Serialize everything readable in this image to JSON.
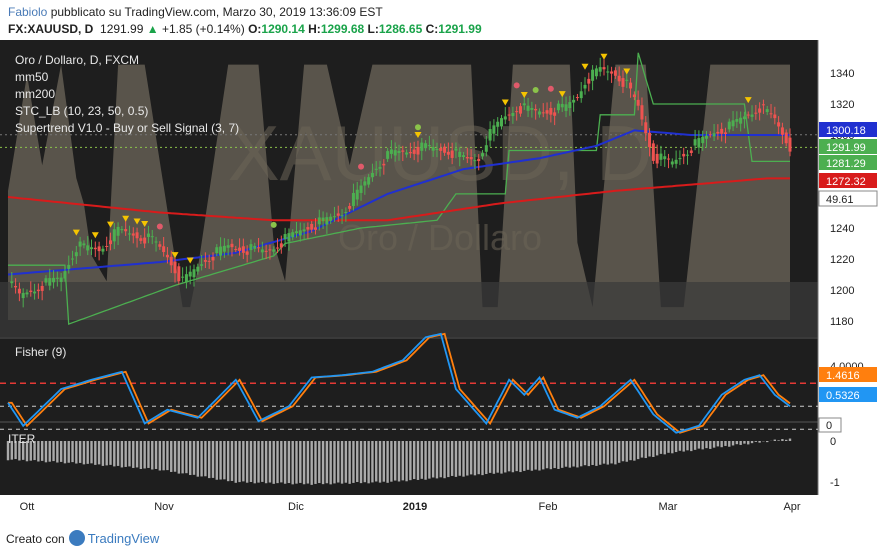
{
  "header": {
    "user": "Fabiolo",
    "published": " pubblicato su TradingView.com, Marzo 30, 2019 13:36:09 EST",
    "symbol": "FX:XAUUSD, D",
    "last": "1291.99",
    "arrow": "▲",
    "change": "+1.85 (+0.14%)",
    "o_label": "O:",
    "o_value": "1290.14",
    "h_label": "H:",
    "h_value": "1299.68",
    "l_label": "L:",
    "l_value": "1286.65",
    "c_label": "C:",
    "c_value": "1291.99"
  },
  "legend": {
    "title": "Oro / Dollaro, D, FXCM",
    "line2": "mm50",
    "line3": "mm200",
    "line4": "STC_LB (10, 23, 50, 0.5)",
    "line5": "Supertrend V1.0 - Buy or Sell Signal (3, 7)"
  },
  "watermark": {
    "symbol": "XAUUSD, D",
    "name": "Oro / Dollaro"
  },
  "footer": {
    "created": "Creato con",
    "brand": "TradingView"
  },
  "colors": {
    "up": "#26a69a",
    "down": "#ef5350",
    "bull_candle": "#4caf50",
    "mm50": "#2030d0",
    "mm200": "#d81b1b",
    "supertrend": "#4caf50",
    "stc_fill": "#8b8271",
    "fisher": "#2196f3",
    "trigger": "#ff7f0e",
    "iter": "#aaaaaa"
  },
  "chart_data": [
    {
      "type": "candlestick",
      "title": "Oro / Dollaro, D, FXCM",
      "ylim": [
        1175,
        1355
      ],
      "y_ticks": [
        1180,
        1200,
        1220,
        1240,
        1260,
        1280,
        1300,
        1320,
        1340
      ],
      "x_ticks": [
        "Ott",
        "Nov",
        "Dic",
        "2019",
        "Feb",
        "Mar",
        "Apr"
      ],
      "price_labels": [
        {
          "value": "1300.18",
          "color": "#2030d0"
        },
        {
          "value": "1291.99",
          "color": "#4caf50"
        },
        {
          "value": "1281.29",
          "color": "#4caf50"
        },
        {
          "value": "1272.32",
          "color": "#d81b1b"
        },
        {
          "value": "49.61",
          "color": "#ffffff"
        }
      ],
      "close_anchors": [
        [
          0,
          1205
        ],
        [
          3,
          1196
        ],
        [
          8,
          1202
        ],
        [
          14,
          1208
        ],
        [
          18,
          1228
        ],
        [
          24,
          1226
        ],
        [
          29,
          1238
        ],
        [
          33,
          1236
        ],
        [
          38,
          1232
        ],
        [
          42,
          1222
        ],
        [
          46,
          1205
        ],
        [
          52,
          1220
        ],
        [
          58,
          1228
        ],
        [
          64,
          1226
        ],
        [
          68,
          1225
        ],
        [
          70,
          1228
        ],
        [
          74,
          1234
        ],
        [
          78,
          1240
        ],
        [
          83,
          1244
        ],
        [
          88,
          1250
        ],
        [
          92,
          1262
        ],
        [
          97,
          1280
        ],
        [
          101,
          1288
        ],
        [
          106,
          1290
        ],
        [
          110,
          1292
        ],
        [
          116,
          1290
        ],
        [
          121,
          1284
        ],
        [
          124,
          1285
        ],
        [
          126,
          1297
        ],
        [
          130,
          1310
        ],
        [
          134,
          1318
        ],
        [
          139,
          1315
        ],
        [
          144,
          1316
        ],
        [
          147,
          1318
        ],
        [
          150,
          1325
        ],
        [
          152,
          1335
        ],
        [
          156,
          1342
        ],
        [
          160,
          1340
        ],
        [
          163,
          1332
        ],
        [
          166,
          1318
        ],
        [
          170,
          1286
        ],
        [
          175,
          1282
        ],
        [
          180,
          1292
        ],
        [
          186,
          1302
        ],
        [
          190,
          1305
        ],
        [
          194,
          1312
        ],
        [
          198,
          1318
        ],
        [
          202,
          1310
        ],
        [
          206,
          1292
        ]
      ],
      "mm50_anchors": [
        [
          0,
          1210
        ],
        [
          20,
          1214
        ],
        [
          40,
          1218
        ],
        [
          60,
          1224
        ],
        [
          80,
          1238
        ],
        [
          100,
          1262
        ],
        [
          120,
          1278
        ],
        [
          140,
          1285
        ],
        [
          155,
          1293
        ],
        [
          165,
          1303
        ],
        [
          180,
          1300
        ],
        [
          200,
          1300
        ],
        [
          206,
          1300
        ]
      ],
      "mm200_anchors": [
        [
          0,
          1260
        ],
        [
          40,
          1250
        ],
        [
          70,
          1245
        ],
        [
          100,
          1245
        ],
        [
          130,
          1256
        ],
        [
          160,
          1264
        ],
        [
          180,
          1268
        ],
        [
          200,
          1272
        ],
        [
          206,
          1272
        ]
      ],
      "supertrend_anchors": [
        [
          0,
          1216
        ],
        [
          15,
          1216
        ],
        [
          16,
          1178
        ],
        [
          44,
          1203
        ],
        [
          70,
          1222
        ],
        [
          73,
          1230
        ],
        [
          93,
          1240
        ],
        [
          113,
          1245
        ],
        [
          118,
          1262
        ],
        [
          131,
          1262
        ],
        [
          132,
          1290
        ],
        [
          155,
          1290
        ],
        [
          156,
          1313
        ],
        [
          165,
          1313
        ],
        [
          166,
          1353
        ],
        [
          170,
          1320
        ],
        [
          192,
          1320
        ],
        [
          194,
          1320
        ],
        [
          196,
          1283
        ],
        [
          206,
          1283
        ]
      ],
      "sell_markers": [
        18,
        23,
        27,
        31,
        34,
        36,
        44,
        48,
        108,
        131,
        136,
        146,
        152,
        157,
        163,
        195
      ],
      "buy_markers": [
        40,
        70,
        93,
        108,
        134,
        139,
        143
      ]
    },
    {
      "type": "area",
      "title": "STC_LB (10, 23, 50, 0.5)",
      "ylim": [
        0,
        100
      ],
      "anchors": [
        [
          0,
          50
        ],
        [
          5,
          95
        ],
        [
          9,
          60
        ],
        [
          14,
          99
        ],
        [
          18,
          55
        ],
        [
          20,
          45
        ],
        [
          22,
          25
        ],
        [
          26,
          15
        ],
        [
          29,
          99
        ],
        [
          36,
          99
        ],
        [
          46,
          5
        ],
        [
          48,
          5
        ],
        [
          50,
          20
        ],
        [
          58,
          99
        ],
        [
          66,
          99
        ],
        [
          70,
          30
        ],
        [
          73,
          15
        ],
        [
          78,
          99
        ],
        [
          84,
          99
        ],
        [
          90,
          60
        ],
        [
          96,
          99
        ],
        [
          104,
          99
        ],
        [
          114,
          99
        ],
        [
          122,
          99
        ],
        [
          125,
          5
        ],
        [
          129,
          5
        ],
        [
          133,
          99
        ],
        [
          142,
          99
        ],
        [
          148,
          99
        ],
        [
          150,
          30
        ],
        [
          154,
          5
        ],
        [
          160,
          99
        ],
        [
          168,
          99
        ],
        [
          172,
          5
        ],
        [
          178,
          5
        ],
        [
          185,
          99
        ],
        [
          198,
          99
        ],
        [
          203,
          99
        ],
        [
          206,
          99
        ]
      ]
    },
    {
      "type": "line",
      "title": "Fisher (9)",
      "ylim": [
        -3,
        5
      ],
      "y_ticks": [
        4.0
      ],
      "level_lines": [
        2.5,
        0.5,
        -1.5
      ],
      "last_values": {
        "fisher": "0.5326",
        "trigger": "1.4616"
      },
      "tick_label": "4.0000",
      "anchors": [
        [
          0,
          0.8
        ],
        [
          4,
          -1.2
        ],
        [
          14,
          2.0
        ],
        [
          22,
          2.8
        ],
        [
          30,
          3.5
        ],
        [
          36,
          -1.0
        ],
        [
          42,
          0.2
        ],
        [
          50,
          -0.5
        ],
        [
          54,
          0.8
        ],
        [
          60,
          2.8
        ],
        [
          66,
          -0.8
        ],
        [
          74,
          0.5
        ],
        [
          80,
          3.0
        ],
        [
          88,
          3.2
        ],
        [
          96,
          3.5
        ],
        [
          104,
          4.5
        ],
        [
          110,
          6.5
        ],
        [
          114,
          6.8
        ],
        [
          118,
          2.0
        ],
        [
          126,
          -1.0
        ],
        [
          132,
          2.8
        ],
        [
          136,
          1.5
        ],
        [
          140,
          3.0
        ],
        [
          144,
          0.2
        ],
        [
          150,
          -0.5
        ],
        [
          156,
          0.5
        ],
        [
          164,
          2.8
        ],
        [
          170,
          -0.2
        ],
        [
          176,
          -1.8
        ],
        [
          182,
          -1.2
        ],
        [
          188,
          1.5
        ],
        [
          194,
          2.8
        ],
        [
          198,
          3.2
        ],
        [
          202,
          1.5
        ],
        [
          206,
          0.5
        ]
      ]
    },
    {
      "type": "bar",
      "title": "ITER",
      "ylim": [
        -1.1,
        0.1
      ],
      "y_ticks": [
        0,
        -1
      ],
      "last_value": "0",
      "anchors": [
        [
          0,
          -0.45
        ],
        [
          20,
          -0.55
        ],
        [
          40,
          -0.7
        ],
        [
          60,
          -1.0
        ],
        [
          80,
          -1.05
        ],
        [
          100,
          -1.0
        ],
        [
          120,
          -0.85
        ],
        [
          140,
          -0.7
        ],
        [
          160,
          -0.55
        ],
        [
          175,
          -0.28
        ],
        [
          190,
          -0.12
        ],
        [
          206,
          0.06
        ]
      ]
    }
  ]
}
